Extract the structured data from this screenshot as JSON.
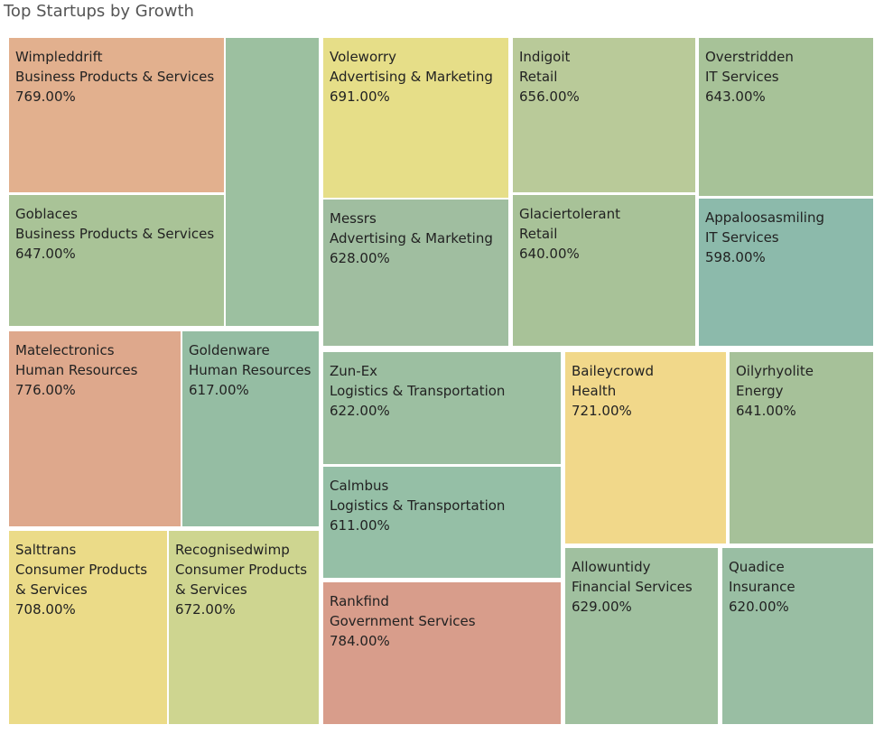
{
  "chart_data": {
    "type": "treemap",
    "title": "Top Startups by Growth",
    "value_format": "percent",
    "items": [
      {
        "name": "Wimpleddrift",
        "category": "Business Products & Services",
        "growth": 769.0,
        "label": "769.00%",
        "color": "#e2b08e"
      },
      {
        "name": "Goblaces",
        "category": "Business Products & Services",
        "growth": 647.0,
        "label": "647.00%",
        "color": "#a9c397"
      },
      {
        "name": "",
        "category": "",
        "growth": null,
        "label": "",
        "color": "#9cc0a0"
      },
      {
        "name": "Voleworry",
        "category": "Advertising & Marketing",
        "growth": 691.0,
        "label": "691.00%",
        "color": "#e6de88"
      },
      {
        "name": "Messrs",
        "category": "Advertising & Marketing",
        "growth": 628.0,
        "label": "628.00%",
        "color": "#a0bea0"
      },
      {
        "name": "Indigoit",
        "category": "Retail",
        "growth": 656.0,
        "label": "656.00%",
        "color": "#b9ca99"
      },
      {
        "name": "Glaciertolerant",
        "category": "Retail",
        "growth": 640.0,
        "label": "640.00%",
        "color": "#a8c298"
      },
      {
        "name": "Overstridden",
        "category": "IT Services",
        "growth": 643.0,
        "label": "643.00%",
        "color": "#a7c298"
      },
      {
        "name": "Appaloosasmiling",
        "category": "IT Services",
        "growth": 598.0,
        "label": "598.00%",
        "color": "#8cbaab"
      },
      {
        "name": "Matelectronics",
        "category": "Human Resources",
        "growth": 776.0,
        "label": "776.00%",
        "color": "#dea88c"
      },
      {
        "name": "Goldenware",
        "category": "Human Resources",
        "growth": 617.0,
        "label": "617.00%",
        "color": "#95bda3"
      },
      {
        "name": "Salttrans",
        "category": "Consumer Products & Services",
        "growth": 708.0,
        "label": "708.00%",
        "color": "#ebdb88"
      },
      {
        "name": "Recognisedwimp",
        "category": "Consumer Products & Services",
        "growth": 672.0,
        "label": "672.00%",
        "color": "#ced590"
      },
      {
        "name": "Zun-Ex",
        "category": "Logistics & Transportation",
        "growth": 622.0,
        "label": "622.00%",
        "color": "#9cbfa1"
      },
      {
        "name": "Calmbus",
        "category": "Logistics & Transportation",
        "growth": 611.0,
        "label": "611.00%",
        "color": "#95bfa6"
      },
      {
        "name": "Rankfind",
        "category": "Government Services",
        "growth": 784.0,
        "label": "784.00%",
        "color": "#d89d8b"
      },
      {
        "name": "Baileycrowd",
        "category": "Health",
        "growth": 721.0,
        "label": "721.00%",
        "color": "#f1d88a"
      },
      {
        "name": "Oilyrhyolite",
        "category": "Energy",
        "growth": 641.0,
        "label": "641.00%",
        "color": "#a6c199"
      },
      {
        "name": "Allowuntidy",
        "category": "Financial Services",
        "growth": 629.0,
        "label": "629.00%",
        "color": "#a0c09f"
      },
      {
        "name": "Quadice",
        "category": "Insurance",
        "growth": 620.0,
        "label": "620.00%",
        "color": "#99bea3"
      }
    ]
  }
}
